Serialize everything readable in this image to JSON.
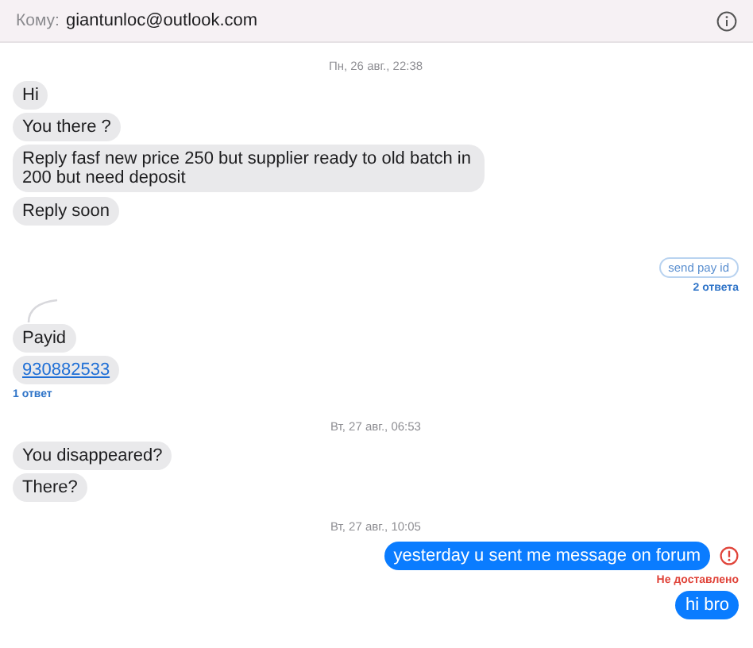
{
  "header": {
    "label": "Кому:",
    "recipient": "giantunloc@outlook.com"
  },
  "items": [
    {
      "kind": "date",
      "text": "Пн, 26 авг., 22:38"
    },
    {
      "kind": "incoming",
      "text": "Hi"
    },
    {
      "kind": "incoming",
      "text": "You there ?"
    },
    {
      "kind": "incoming",
      "text": "Reply fasf new price 250 but supplier ready to old batch in 200 but need deposit"
    },
    {
      "kind": "incoming",
      "text": "Reply soon"
    },
    {
      "kind": "quoted",
      "text": "send pay id"
    },
    {
      "kind": "replies-out",
      "text": "2 ответа"
    },
    {
      "kind": "incoming",
      "text": "Payid",
      "thread": true
    },
    {
      "kind": "incoming",
      "text": "930882533",
      "link": true
    },
    {
      "kind": "replies-in",
      "text": "1 ответ"
    },
    {
      "kind": "date",
      "text": "Вт, 27 авг., 06:53"
    },
    {
      "kind": "incoming",
      "text": "You disappeared?"
    },
    {
      "kind": "incoming",
      "text": "There?"
    },
    {
      "kind": "date",
      "text": "Вт, 27 авг., 10:05"
    },
    {
      "kind": "outgoing",
      "text": "yesterday u sent me message on forum",
      "failed": true
    },
    {
      "kind": "status",
      "text": "Не доставлено"
    },
    {
      "kind": "outgoing",
      "text": "hi bro"
    }
  ]
}
